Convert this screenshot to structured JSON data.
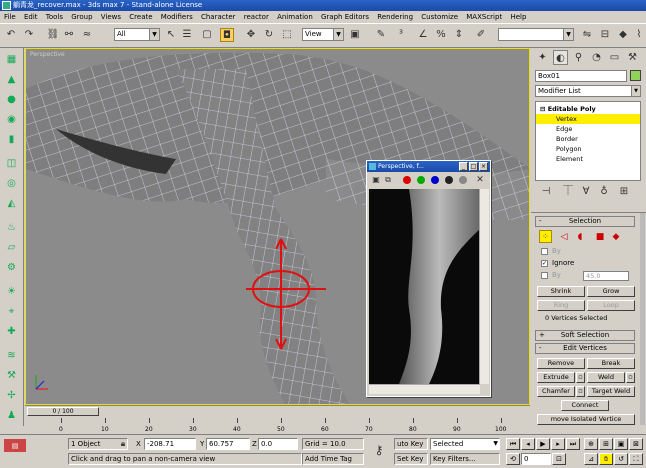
{
  "window": {
    "title": "躺青龙_recover.max - 3ds max 7   - Stand-alone License"
  },
  "menu": [
    "File",
    "Edit",
    "Tools",
    "Group",
    "Views",
    "Create",
    "Modifiers",
    "Character",
    "reactor",
    "Animation",
    "Graph Editors",
    "Rendering",
    "Customize",
    "MAXScript",
    "Help"
  ],
  "toolbar": {
    "selection_filter": "All",
    "reference_coord": "View",
    "named_selection": ""
  },
  "viewport": {
    "label": "Perspective"
  },
  "float_window": {
    "title": "Perspective, f..."
  },
  "command_panel": {
    "object_name": "Box01",
    "object_color": "#8fd35a",
    "modifier_list": "Modifier List",
    "stack": [
      "Editable Poly",
      "Vertex",
      "Edge",
      "Border",
      "Polygon",
      "Element"
    ],
    "stack_selected": "Vertex"
  },
  "selection_rollout": {
    "title": "Selection",
    "by_vertex_label": "By",
    "ignore_label": "Ignore",
    "by_angle_label": "By",
    "angle_value": "45.0",
    "shrink": "Shrink",
    "grow": "Grow",
    "ring": "Ring",
    "loop": "Loop",
    "status": "0 Vertices Selected"
  },
  "soft_selection": {
    "title": "Soft Selection",
    "sign": "+"
  },
  "edit_vertices": {
    "title": "Edit Vertices",
    "sign": "-",
    "remove": "Remove",
    "break": "Break",
    "extrude": "Extrude",
    "weld": "Weld",
    "chamfer": "Chamfer",
    "target_weld": "Target Weld",
    "connect": "Connect",
    "remove_isolated": "move Isolated Vertice"
  },
  "timeline": {
    "thumb": "0 / 100",
    "ticks": [
      "0",
      "10",
      "20",
      "30",
      "40",
      "50",
      "60",
      "70",
      "80",
      "90",
      "100"
    ]
  },
  "status": {
    "objects": "1 Object",
    "x_label": "X",
    "x": "-208.71",
    "y_label": "Y",
    "y": "60.757",
    "z_label": "Z",
    "z": "0.0",
    "grid": "Grid = 10.0",
    "prompt": "Click and drag to pan a non-camera view",
    "add_time_tag": "Add Time Tag",
    "auto_key": "uto Key",
    "set_key": "Set Key",
    "selected": "Selected",
    "key_filters": "Key Filters...",
    "frame": "0"
  }
}
